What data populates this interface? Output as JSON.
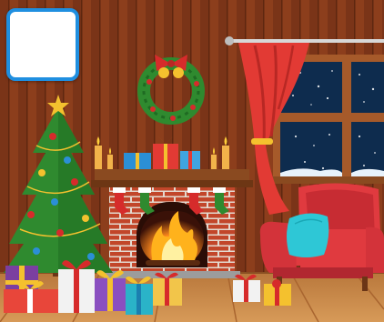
{
  "game": {
    "scene": "christmas-living-room",
    "inventory_slot": {
      "item": null
    }
  },
  "colors": {
    "wall_dark": "#7a3418",
    "wall_stripe": "#8f3f1d",
    "floor": "#c98a4a",
    "curtain": "#e23a34",
    "night_sky": "#0e2c4e",
    "slot_border": "#1f8fe0"
  },
  "icons": [
    "christmas-tree",
    "fireplace",
    "wreath",
    "armchair",
    "window",
    "gift-box",
    "candle",
    "stocking"
  ]
}
